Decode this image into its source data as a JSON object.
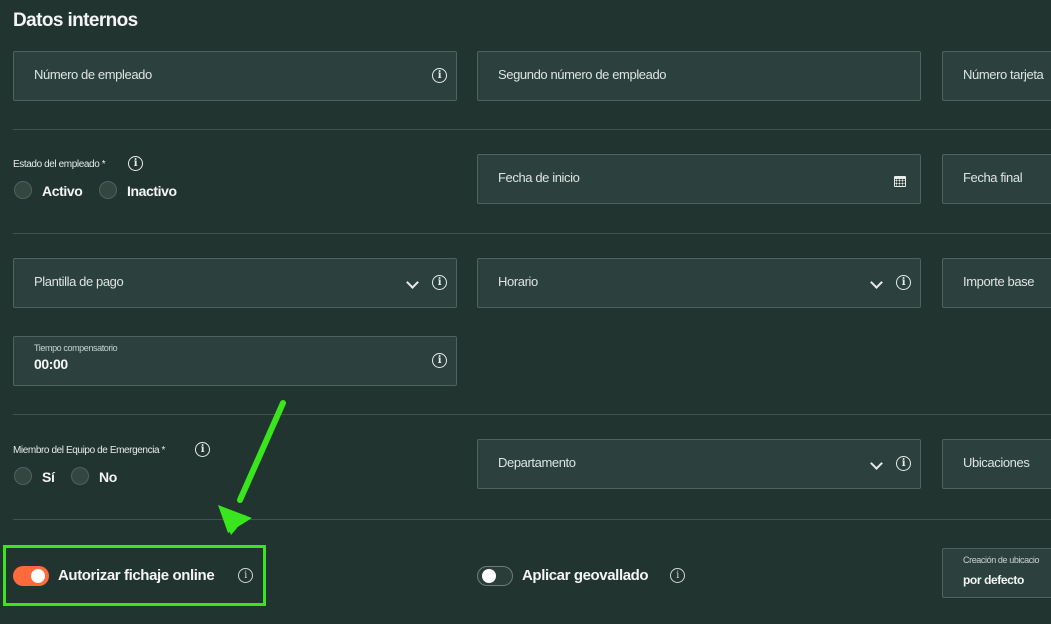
{
  "section_title": "Datos internos",
  "fields": {
    "employee_number": "Número de empleado",
    "second_employee_number": "Segundo número de empleado",
    "card_number": "Número tarjeta",
    "start_date": "Fecha de inicio",
    "end_date": "Fecha final",
    "pay_template": "Plantilla de pago",
    "schedule": "Horario",
    "base_amount": "Importe base",
    "comp_time_label": "Tiempo compensatorio",
    "comp_time_value": "00:00",
    "department": "Departamento",
    "locations": "Ubicaciones",
    "creation_label": "Creación de ubicacio",
    "creation_value": "por defecto"
  },
  "employee_status": {
    "label": "Estado del empleado *",
    "options": [
      "Activo",
      "Inactivo"
    ]
  },
  "emergency_team": {
    "label": "Miembro del Equipo de Emergencia *",
    "options": [
      "Sí",
      "No"
    ]
  },
  "toggles": {
    "online_clock_in": {
      "label": "Autorizar fichaje online",
      "state": "on"
    },
    "geofence": {
      "label": "Aplicar geovallado",
      "state": "off"
    }
  },
  "icons": {
    "info": "i"
  },
  "colors": {
    "background": "#223430",
    "field_bg": "#2c413d",
    "toggle_on": "#ff6a3d",
    "annotation": "#39e61e"
  }
}
